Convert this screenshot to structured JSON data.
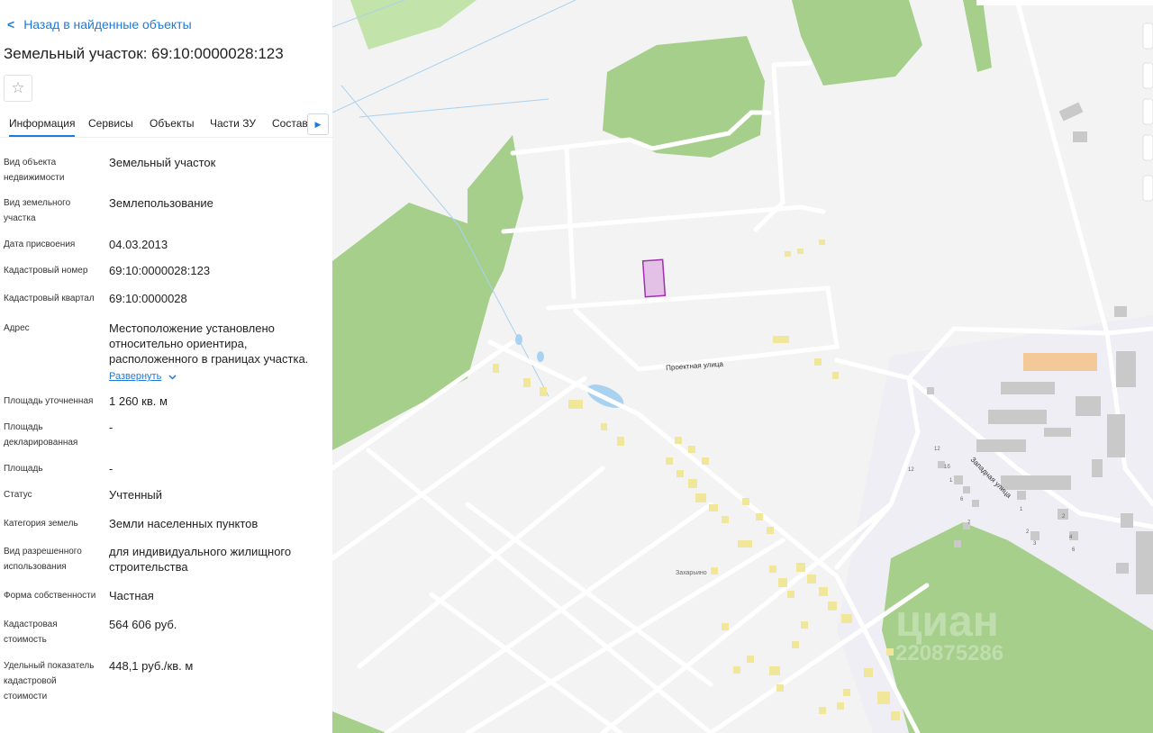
{
  "back_link": {
    "label": "Назад в найденные объекты"
  },
  "page_title": "Земельный участок: 69:10:0000028:123",
  "tabs": [
    {
      "label": "Информация"
    },
    {
      "label": "Сервисы"
    },
    {
      "label": "Объекты"
    },
    {
      "label": "Части ЗУ"
    },
    {
      "label": "Состав"
    }
  ],
  "fields": [
    {
      "label": "Вид объекта недвижимости",
      "value": "Земельный участок"
    },
    {
      "label": "Вид земельного участка",
      "value": "Землепользование"
    },
    {
      "label": "Дата присвоения",
      "value": "04.03.2013"
    },
    {
      "label": "Кадастровый номер",
      "value": "69:10:0000028:123"
    },
    {
      "label": "Кадастровый квартал",
      "value": "69:10:0000028"
    },
    {
      "label": "Адрес",
      "value": "Местоположение установлено относительно ориентира, расположенного в границах участка.",
      "expand_label": "Развернуть"
    },
    {
      "label": "Площадь уточненная",
      "value": "1 260 кв. м"
    },
    {
      "label": "Площадь декларированная",
      "value": "-"
    },
    {
      "label": "Площадь",
      "value": "-"
    },
    {
      "label": "Статус",
      "value": "Учтенный"
    },
    {
      "label": "Категория земель",
      "value": "Земли населенных пунктов"
    },
    {
      "label": "Вид разрешенного использования",
      "value": "для индивидуального жилищного строительства"
    },
    {
      "label": "Форма собственности",
      "value": "Частная"
    },
    {
      "label": "Кадастровая стоимость",
      "value": "564 606 руб."
    },
    {
      "label": "Удельный показатель кадастровой стоимости",
      "value": "448,1 руб./кв. м"
    }
  ],
  "map": {
    "street_labels": [
      "Проектная улица",
      "Западная улица"
    ],
    "village_label": "Захарьино",
    "watermark": "циан",
    "watermark_number": "220875286",
    "house_numbers": [
      "12",
      "12",
      "1б",
      "1",
      "6",
      "7",
      "1",
      "2",
      "3",
      "2",
      "4",
      "6"
    ],
    "colors": {
      "forest": "#a5cf8b",
      "plot_fill": "#e3c1e6",
      "plot_border": "#a030b0",
      "building": "#f0e79a",
      "road": "#ffffff"
    }
  }
}
